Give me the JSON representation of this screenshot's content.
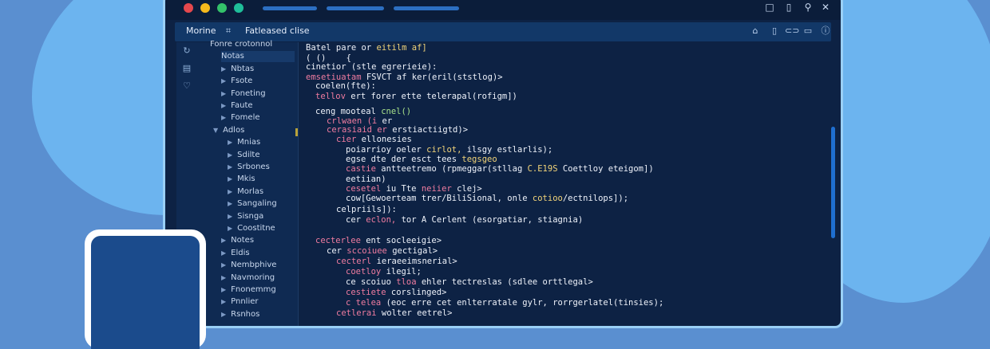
{
  "colors": {
    "background": "#5a8fd0",
    "window": "#0d2244",
    "accent": "#2c6fc2",
    "red": "#f07ca0",
    "yellow": "#f2d479",
    "green": "#a7e08a"
  },
  "window_controls": {
    "dots": [
      "#e5484d",
      "#f5b91c",
      "#34c26a",
      "#1fbf9a"
    ],
    "icons": [
      "window-icon",
      "copy-icon",
      "pin-icon",
      "close-icon"
    ],
    "icon_glyphs": [
      "□",
      "▯",
      "⚲",
      "✕"
    ]
  },
  "toolbar": {
    "left_label": "Morine",
    "icon_glyph": "⌗",
    "tab_label": "Fatleased clise",
    "icons": [
      "lock-icon",
      "file-icon",
      "link-icon",
      "copy-icon",
      "info-icon"
    ],
    "icon_glyphs": [
      "⌂",
      "▯",
      "⊂⊃",
      "▭",
      "ⓘ"
    ]
  },
  "activity_icons": [
    {
      "name": "refresh-icon",
      "glyph": "↻"
    },
    {
      "name": "files-icon",
      "glyph": "▤"
    },
    {
      "name": "heart-icon",
      "glyph": "♡"
    }
  ],
  "sidebar": {
    "rows": [
      {
        "label": "Fonre crotonnol",
        "level": 0,
        "chevron": ""
      },
      {
        "label": "Notas",
        "level": 1,
        "chevron": "",
        "selected": true
      },
      {
        "label": "Nbtas",
        "level": 1,
        "chevron": "▶"
      },
      {
        "label": "Fsote",
        "level": 1,
        "chevron": "▶"
      },
      {
        "label": "Foneting",
        "level": 1,
        "chevron": "▶"
      },
      {
        "label": "Faute",
        "level": 1,
        "chevron": "▶"
      },
      {
        "label": "Fomele",
        "level": 1,
        "chevron": "▶"
      },
      {
        "label": "Adlos",
        "level": 0,
        "chevron": "▼"
      },
      {
        "label": "Mnias",
        "level": 2,
        "chevron": "▶"
      },
      {
        "label": "Sdilte",
        "level": 2,
        "chevron": "▶"
      },
      {
        "label": "Srbones",
        "level": 2,
        "chevron": "▶"
      },
      {
        "label": "Mkis",
        "level": 2,
        "chevron": "▶"
      },
      {
        "label": "Morlas",
        "level": 2,
        "chevron": "▶"
      },
      {
        "label": "Sangaling",
        "level": 2,
        "chevron": "▶"
      },
      {
        "label": "Sisnga",
        "level": 2,
        "chevron": "▶"
      },
      {
        "label": "Coostitne",
        "level": 2,
        "chevron": "▶"
      },
      {
        "label": "Notes",
        "level": 1,
        "chevron": "▶"
      },
      {
        "label": "Eldis",
        "level": 1,
        "chevron": "▶"
      },
      {
        "label": "Nembphive",
        "level": 1,
        "chevron": "▶"
      },
      {
        "label": "Navmoring",
        "level": 1,
        "chevron": "▶"
      },
      {
        "label": "Fnonemmg",
        "level": 1,
        "chevron": "▶"
      },
      {
        "label": "Pnnlier",
        "level": 1,
        "chevron": "▶"
      },
      {
        "label": "Rsnhos",
        "level": 1,
        "chevron": "▶"
      }
    ]
  },
  "editor": {
    "lines": [
      {
        "indent": 0,
        "segments": [
          {
            "t": "Batel pare or ",
            "c": "wht"
          },
          {
            "t": "eitilm af]",
            "c": "yel"
          }
        ]
      },
      {
        "indent": 0,
        "segments": [
          {
            "t": "( ()    {",
            "c": "wht"
          }
        ]
      },
      {
        "indent": 0,
        "segments": [
          {
            "t": "cinetior (stle egrerieie):",
            "c": "wht"
          }
        ]
      },
      {
        "indent": 0,
        "segments": [
          {
            "t": "emsetiuatam ",
            "c": "red"
          },
          {
            "t": "FSVCT af ker(eril(ststlog)>",
            "c": "wht"
          }
        ]
      },
      {
        "indent": 1,
        "segments": [
          {
            "t": "coelen(fte):",
            "c": "wht"
          }
        ]
      },
      {
        "indent": 1,
        "segments": [
          {
            "t": "tellov ",
            "c": "red"
          },
          {
            "t": "ert forer ette telerapal(rofigm])",
            "c": "wht"
          }
        ]
      },
      {
        "indent": 0,
        "segments": [
          {
            "t": "",
            "c": "wht"
          }
        ]
      },
      {
        "indent": 1,
        "segments": [
          {
            "t": "ceng mooteal ",
            "c": "wht"
          },
          {
            "t": "cnel()",
            "c": "grn"
          }
        ]
      },
      {
        "indent": 2,
        "segments": [
          {
            "t": "crlwaen (i ",
            "c": "red"
          },
          {
            "t": "er",
            "c": "wht"
          }
        ]
      },
      {
        "indent": 2,
        "segments": [
          {
            "t": "cerasiaid er ",
            "c": "red"
          },
          {
            "t": "erstiactiigtd)>",
            "c": "wht"
          }
        ]
      },
      {
        "indent": 3,
        "segments": [
          {
            "t": "cier ",
            "c": "red"
          },
          {
            "t": "ellonesies",
            "c": "wht"
          }
        ]
      },
      {
        "indent": 4,
        "segments": [
          {
            "t": "poiarrioy oeler ",
            "c": "wht"
          },
          {
            "t": "cirlot, ",
            "c": "yel"
          },
          {
            "t": "ilsgy estlarlis);",
            "c": "wht"
          }
        ]
      },
      {
        "indent": 4,
        "segments": [
          {
            "t": "egse dte der esct tees ",
            "c": "wht"
          },
          {
            "t": "tegsgeo",
            "c": "yel"
          }
        ]
      },
      {
        "indent": 4,
        "segments": [
          {
            "t": "castie ",
            "c": "red"
          },
          {
            "t": "antteetremo (rpmeggar(stllag ",
            "c": "wht"
          },
          {
            "t": "C.E19S ",
            "c": "yel"
          },
          {
            "t": "Coettloy eteigom])",
            "c": "wht"
          }
        ]
      },
      {
        "indent": 4,
        "segments": [
          {
            "t": "eetiian)",
            "c": "wht"
          }
        ]
      },
      {
        "indent": 4,
        "segments": [
          {
            "t": "cesetel ",
            "c": "red"
          },
          {
            "t": "iu Tte ",
            "c": "wht"
          },
          {
            "t": "neiier ",
            "c": "red"
          },
          {
            "t": "clej>",
            "c": "wht"
          }
        ]
      },
      {
        "indent": 4,
        "segments": [
          {
            "t": "cow[Gewoerteam ",
            "c": "wht"
          },
          {
            "t": "trer/BiliSional, ",
            "c": "wht"
          },
          {
            "t": "onle ",
            "c": "wht"
          },
          {
            "t": "cotioo",
            "c": "yel"
          },
          {
            "t": "/ectnilops]);",
            "c": "wht"
          }
        ]
      },
      {
        "indent": 3,
        "segments": [
          {
            "t": "celpriils]):",
            "c": "wht"
          }
        ]
      },
      {
        "indent": 4,
        "segments": [
          {
            "t": "cer ",
            "c": "wht"
          },
          {
            "t": "eclon, ",
            "c": "red"
          },
          {
            "t": "tor A Cerlent (esorgatiar, stiagnia)",
            "c": "wht"
          }
        ]
      },
      {
        "indent": 0,
        "segments": [
          {
            "t": "",
            "c": "wht"
          }
        ]
      },
      {
        "indent": 1,
        "segments": [
          {
            "t": "cecterlee ",
            "c": "red"
          },
          {
            "t": "ent socleeigie>",
            "c": "wht"
          }
        ]
      },
      {
        "indent": 2,
        "segments": [
          {
            "t": "cer ",
            "c": "wht"
          },
          {
            "t": "sccoiuee ",
            "c": "red"
          },
          {
            "t": "gectigal>",
            "c": "wht"
          }
        ]
      },
      {
        "indent": 3,
        "segments": [
          {
            "t": "cecterl ",
            "c": "red"
          },
          {
            "t": "ieraeeimsnerial>",
            "c": "wht"
          }
        ]
      },
      {
        "indent": 4,
        "segments": [
          {
            "t": "coetloy ",
            "c": "red"
          },
          {
            "t": "ilegil;",
            "c": "wht"
          }
        ]
      },
      {
        "indent": 4,
        "segments": [
          {
            "t": "ce ",
            "c": "wht"
          },
          {
            "t": "scoiuo ",
            "c": "wht"
          },
          {
            "t": "tloa ",
            "c": "red"
          },
          {
            "t": "ehler tectreslas (sdlee orttlegal>",
            "c": "wht"
          }
        ]
      },
      {
        "indent": 4,
        "segments": [
          {
            "t": "cestiete ",
            "c": "red"
          },
          {
            "t": "corslinged>",
            "c": "wht"
          }
        ]
      },
      {
        "indent": 4,
        "segments": [
          {
            "t": "c telea ",
            "c": "red"
          },
          {
            "t": "(eoc erre cet enlterratale gylr, rorrgerlatel(tinsies);",
            "c": "wht"
          }
        ]
      },
      {
        "indent": 3,
        "segments": [
          {
            "t": "cetlerai ",
            "c": "red"
          },
          {
            "t": "wolter eetrel>",
            "c": "wht"
          }
        ]
      }
    ]
  }
}
